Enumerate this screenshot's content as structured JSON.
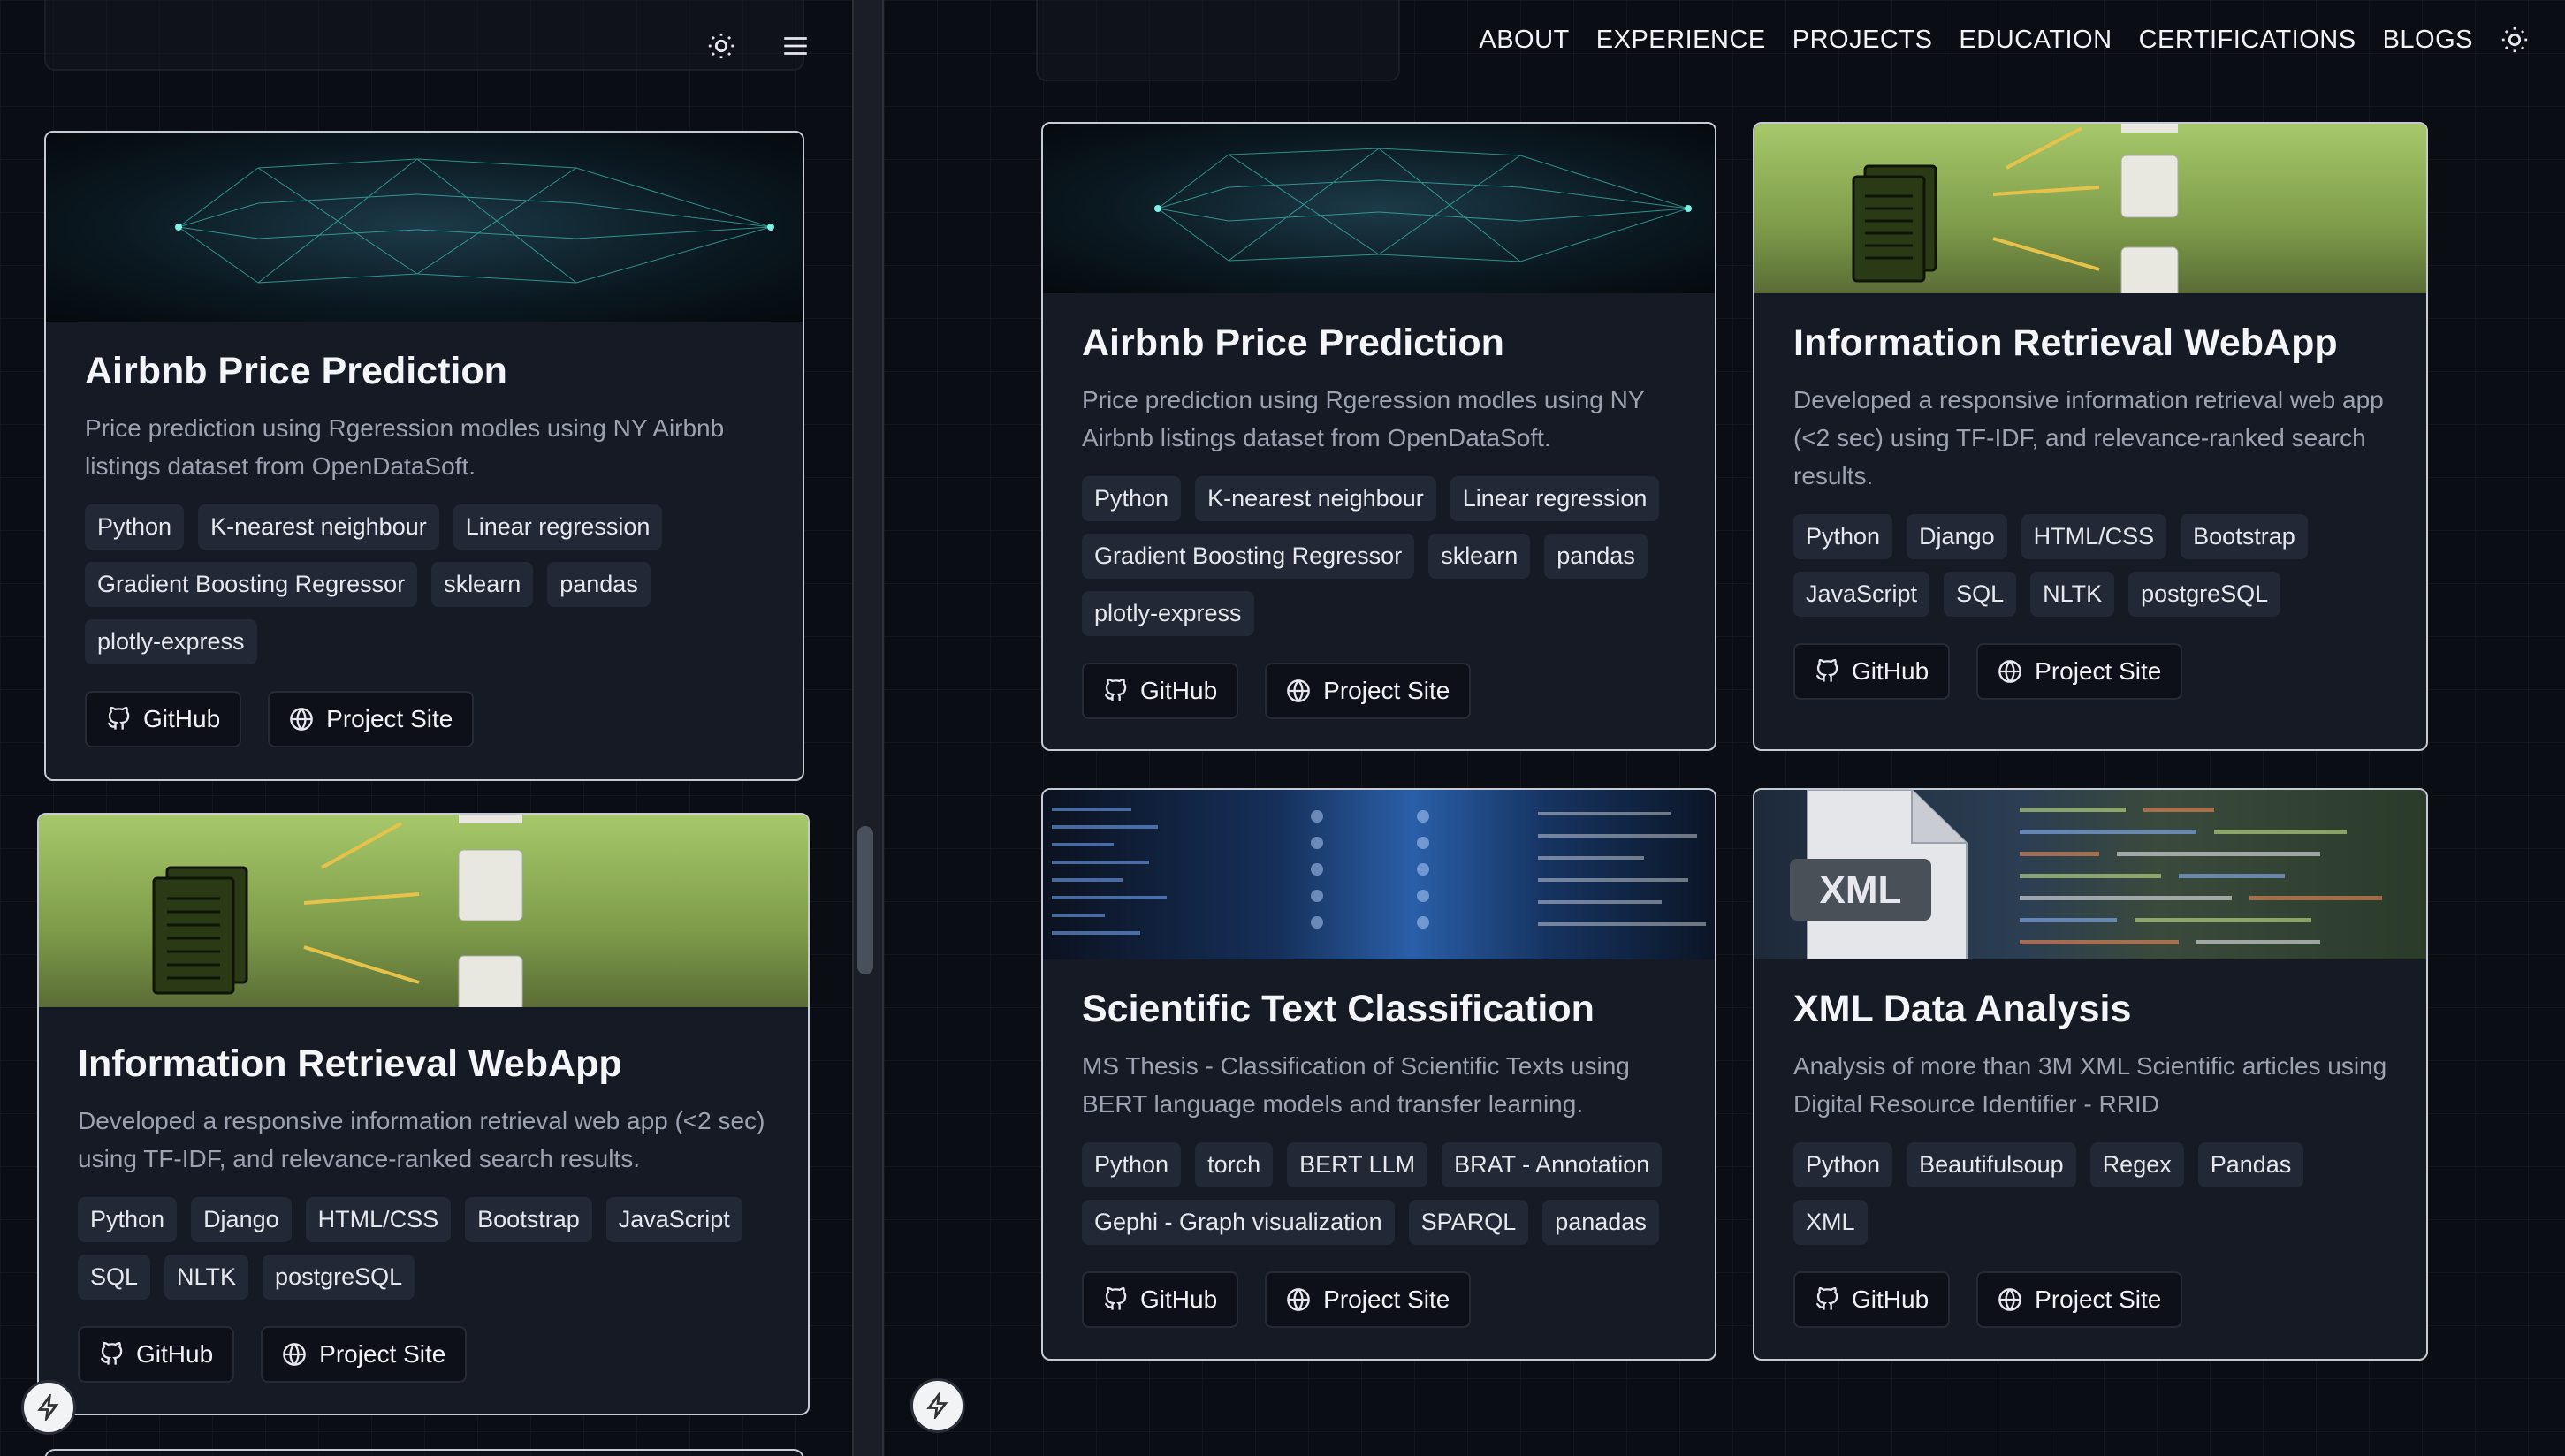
{
  "nav": {
    "items": [
      "ABOUT",
      "EXPERIENCE",
      "PROJECTS",
      "EDUCATION",
      "CERTIFICATIONS",
      "BLOGS"
    ]
  },
  "buttons": {
    "github": "GitHub",
    "project_site": "Project Site"
  },
  "projects": {
    "airbnb": {
      "title": "Airbnb Price Prediction",
      "description": "Price prediction using Rgeression modles using NY Airbnb listings dataset from OpenDataSoft.",
      "tags": [
        "Python",
        "K-nearest neighbour",
        "Linear regression",
        "Gradient Boosting Regressor",
        "sklearn",
        "pandas",
        "plotly-express"
      ]
    },
    "ir": {
      "title": "Information Retrieval WebApp",
      "description": "Developed a responsive information retrieval web app (<2 sec) using TF-IDF, and relevance-ranked search results.",
      "tags": [
        "Python",
        "Django",
        "HTML/CSS",
        "Bootstrap",
        "JavaScript",
        "SQL",
        "NLTK",
        "postgreSQL"
      ]
    },
    "sci": {
      "title": "Scientific Text Classification",
      "description": "MS Thesis - Classification of Scientific Texts using BERT language models and transfer learning.",
      "tags": [
        "Python",
        "torch",
        "BERT LLM",
        "BRAT - Annotation",
        "Gephi - Graph visualization",
        "SPARQL",
        "panadas"
      ]
    },
    "xml": {
      "title": "XML Data Analysis",
      "description": "Analysis of more than 3M XML Scientific articles using Digital Resource Identifier - RRID",
      "tags": [
        "Python",
        "Beautifulsoup",
        "Regex",
        "Pandas",
        "XML"
      ]
    }
  },
  "banner_text": {
    "xml": "XML"
  },
  "icons": {
    "theme": "sun-icon",
    "menu": "hamburger-menu-icon",
    "github": "github-icon",
    "site": "globe-icon",
    "bolt": "lightning-bolt-icon"
  }
}
